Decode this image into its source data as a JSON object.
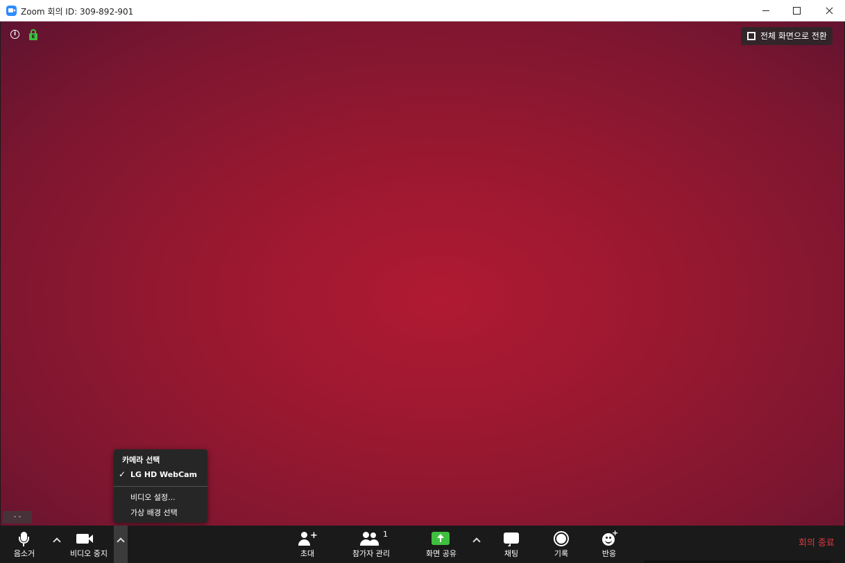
{
  "window": {
    "title": "Zoom 회의 ID: 309-892-901"
  },
  "overlay": {
    "info_glyph": "i",
    "lock_glyph": "E",
    "fullscreen_label": "전체 화면으로 전환",
    "self_view_name": "- -"
  },
  "camera_menu": {
    "header": "카메라 선택",
    "selected_camera": "LG HD WebCam",
    "check_glyph": "✓",
    "items": [
      "비디오 설정...",
      "가상 배경 선택"
    ]
  },
  "toolbar": {
    "mute_label": "음소거",
    "video_label": "비디오 중지",
    "invite_label": "초대",
    "participants_label": "참가자 관리",
    "participants_count": "1",
    "share_label": "화면 공유",
    "chat_label": "채팅",
    "record_label": "기록",
    "reactions_label": "반응",
    "end_label": "회의 종료",
    "plus_glyph": "+"
  },
  "colors": {
    "video_background": "#a01a32",
    "share_green": "#3fbf3f",
    "lock_green": "#3fbf3f",
    "end_red": "#e0383e",
    "zoom_blue": "#2d8cff"
  },
  "icons": {
    "app": "zoom-logo-icon",
    "info": "info-icon",
    "lock": "lock-icon",
    "fullscreen": "fullscreen-icon",
    "mute": "microphone-icon",
    "video": "video-camera-icon",
    "invite": "add-person-icon",
    "participants": "people-icon",
    "share": "share-screen-icon",
    "chat": "chat-bubble-icon",
    "record": "record-icon",
    "reactions": "smiley-icon"
  }
}
